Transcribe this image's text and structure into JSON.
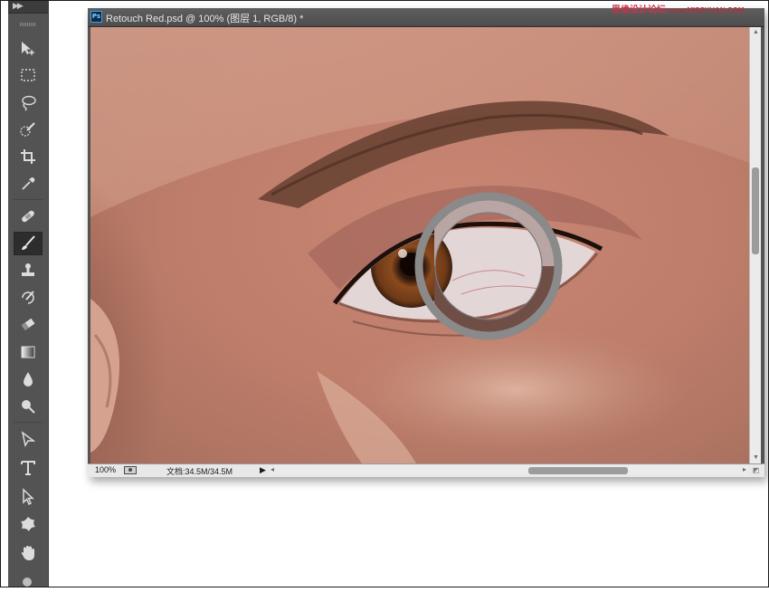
{
  "document": {
    "title": "Retouch Red.psd @ 100% (图层 1, RGB/8) *",
    "app_icon_label": "Ps"
  },
  "watermark": {
    "text": "思缘设计论坛",
    "url_text": "www.MISSYUAN.COM"
  },
  "status": {
    "zoom": "100%",
    "doc_size": "文档:34.5M/34.5M"
  },
  "toolbar": {
    "collapse_label": "▶▶",
    "tools": [
      {
        "name": "move-tool",
        "icon": "move-icon"
      },
      {
        "name": "marquee-tool",
        "icon": "marquee-icon"
      },
      {
        "name": "lasso-tool",
        "icon": "lasso-icon"
      },
      {
        "name": "quick-selection-tool",
        "icon": "quick-selection-icon"
      },
      {
        "name": "crop-tool",
        "icon": "crop-icon"
      },
      {
        "name": "eyedropper-tool",
        "icon": "eyedropper-icon"
      },
      {
        "name": "healing-brush-tool",
        "icon": "bandage-icon"
      },
      {
        "name": "brush-tool",
        "icon": "brush-icon",
        "active": true
      },
      {
        "name": "clone-stamp-tool",
        "icon": "stamp-icon"
      },
      {
        "name": "history-brush-tool",
        "icon": "history-brush-icon"
      },
      {
        "name": "eraser-tool",
        "icon": "eraser-icon"
      },
      {
        "name": "gradient-tool",
        "icon": "gradient-icon"
      },
      {
        "name": "blur-tool",
        "icon": "drop-icon"
      },
      {
        "name": "dodge-tool",
        "icon": "dodge-icon"
      },
      {
        "name": "path-selection-tool",
        "icon": "path-select-icon"
      },
      {
        "name": "type-tool",
        "icon": "type-icon"
      },
      {
        "name": "direct-selection-tool",
        "icon": "arrow-icon"
      },
      {
        "name": "custom-shape-tool",
        "icon": "shape-icon"
      },
      {
        "name": "hand-tool",
        "icon": "hand-icon"
      }
    ]
  },
  "colors": {
    "panel": "#535353",
    "canvas_skin": "#c98e7a",
    "sampler_ring": "#8a8a8a",
    "sampler_top": "#b9a6a4",
    "sampler_bottom": "#6f4e46"
  }
}
